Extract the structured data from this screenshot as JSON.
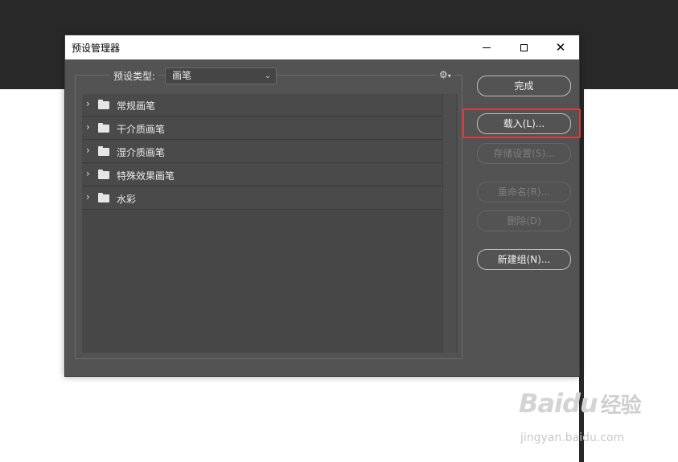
{
  "dialog": {
    "title": "预设管理器",
    "window_controls": {
      "close": "✕"
    }
  },
  "preset_type": {
    "label": "预设类型:",
    "selected": "画笔"
  },
  "list": {
    "items": [
      {
        "label": "常规画笔"
      },
      {
        "label": "干介质画笔"
      },
      {
        "label": "湿介质画笔"
      },
      {
        "label": "特殊效果画笔"
      },
      {
        "label": "水彩"
      }
    ]
  },
  "buttons": {
    "done": "完成",
    "load": "载入(L)...",
    "save_set": "存储设置(S)...",
    "rename": "重命名(R)...",
    "delete": "删除(D)",
    "new_group": "新建组(N)..."
  },
  "watermark": {
    "logo_text": "Baidu",
    "logo_suffix": "经验",
    "url": "jingyan.baidu.com"
  },
  "colors": {
    "dialog_bg": "#535353",
    "highlight": "#e0393a"
  },
  "icons": {
    "gear": "gear-icon",
    "folder": "folder-icon",
    "chevron": "chevron-right-icon"
  }
}
